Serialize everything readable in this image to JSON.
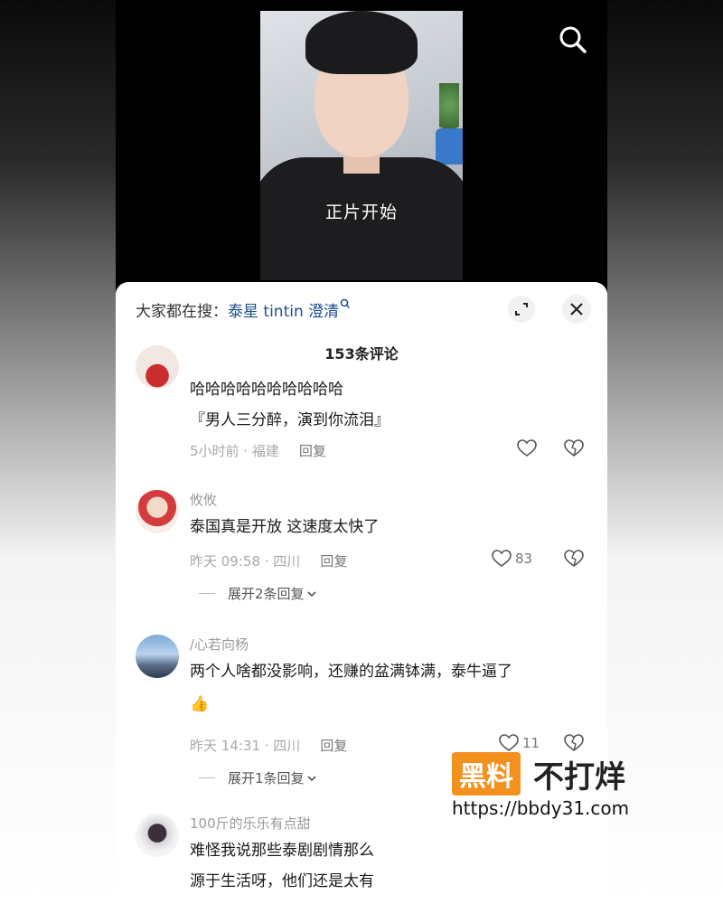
{
  "video": {
    "caption": "正片开始"
  },
  "comment_sheet": {
    "search_prefix": "大家都在搜：",
    "search_term": "泰星 tintin 澄清",
    "comment_count": "153条评论"
  },
  "comments": [
    {
      "username": "",
      "lines": [
        "哈哈哈哈哈哈哈哈哈哈",
        "『男人三分醉，演到你流泪』"
      ],
      "time_location": "5小时前 · 福建",
      "reply_label": "回复",
      "likes": ""
    },
    {
      "username": "攸攸",
      "lines": [
        "泰国真是开放 这速度太快了"
      ],
      "time_location": "昨天 09:58 · 四川",
      "reply_label": "回复",
      "likes": "83",
      "expand_label": "展开2条回复"
    },
    {
      "username": "/心若向杨",
      "lines": [
        "两个人啥都没影响，还赚的盆满钵满，泰牛逼了",
        "👍"
      ],
      "time_location": "昨天 14:31 · 四川",
      "reply_label": "回复",
      "likes": "11",
      "expand_label": "展开1条回复"
    },
    {
      "username": "100斤的乐乐有点甜",
      "lines": [
        "难怪我说那些泰剧剧情那么",
        "源于生活呀，他们还是太有"
      ],
      "time_location": "",
      "reply_label": "",
      "likes": ""
    }
  ],
  "watermark": {
    "badge": "黑料",
    "text": "不打烊",
    "url": "https://bbdy31.com"
  },
  "icons": {
    "search": "search-icon",
    "expand": "expand-icon",
    "close": "close-icon",
    "like": "heart-icon",
    "dislike": "broken-heart-icon",
    "chevron": "chevron-down-icon"
  },
  "colors": {
    "link": "#1e4f8f",
    "watermark_badge": "#f2911e"
  }
}
